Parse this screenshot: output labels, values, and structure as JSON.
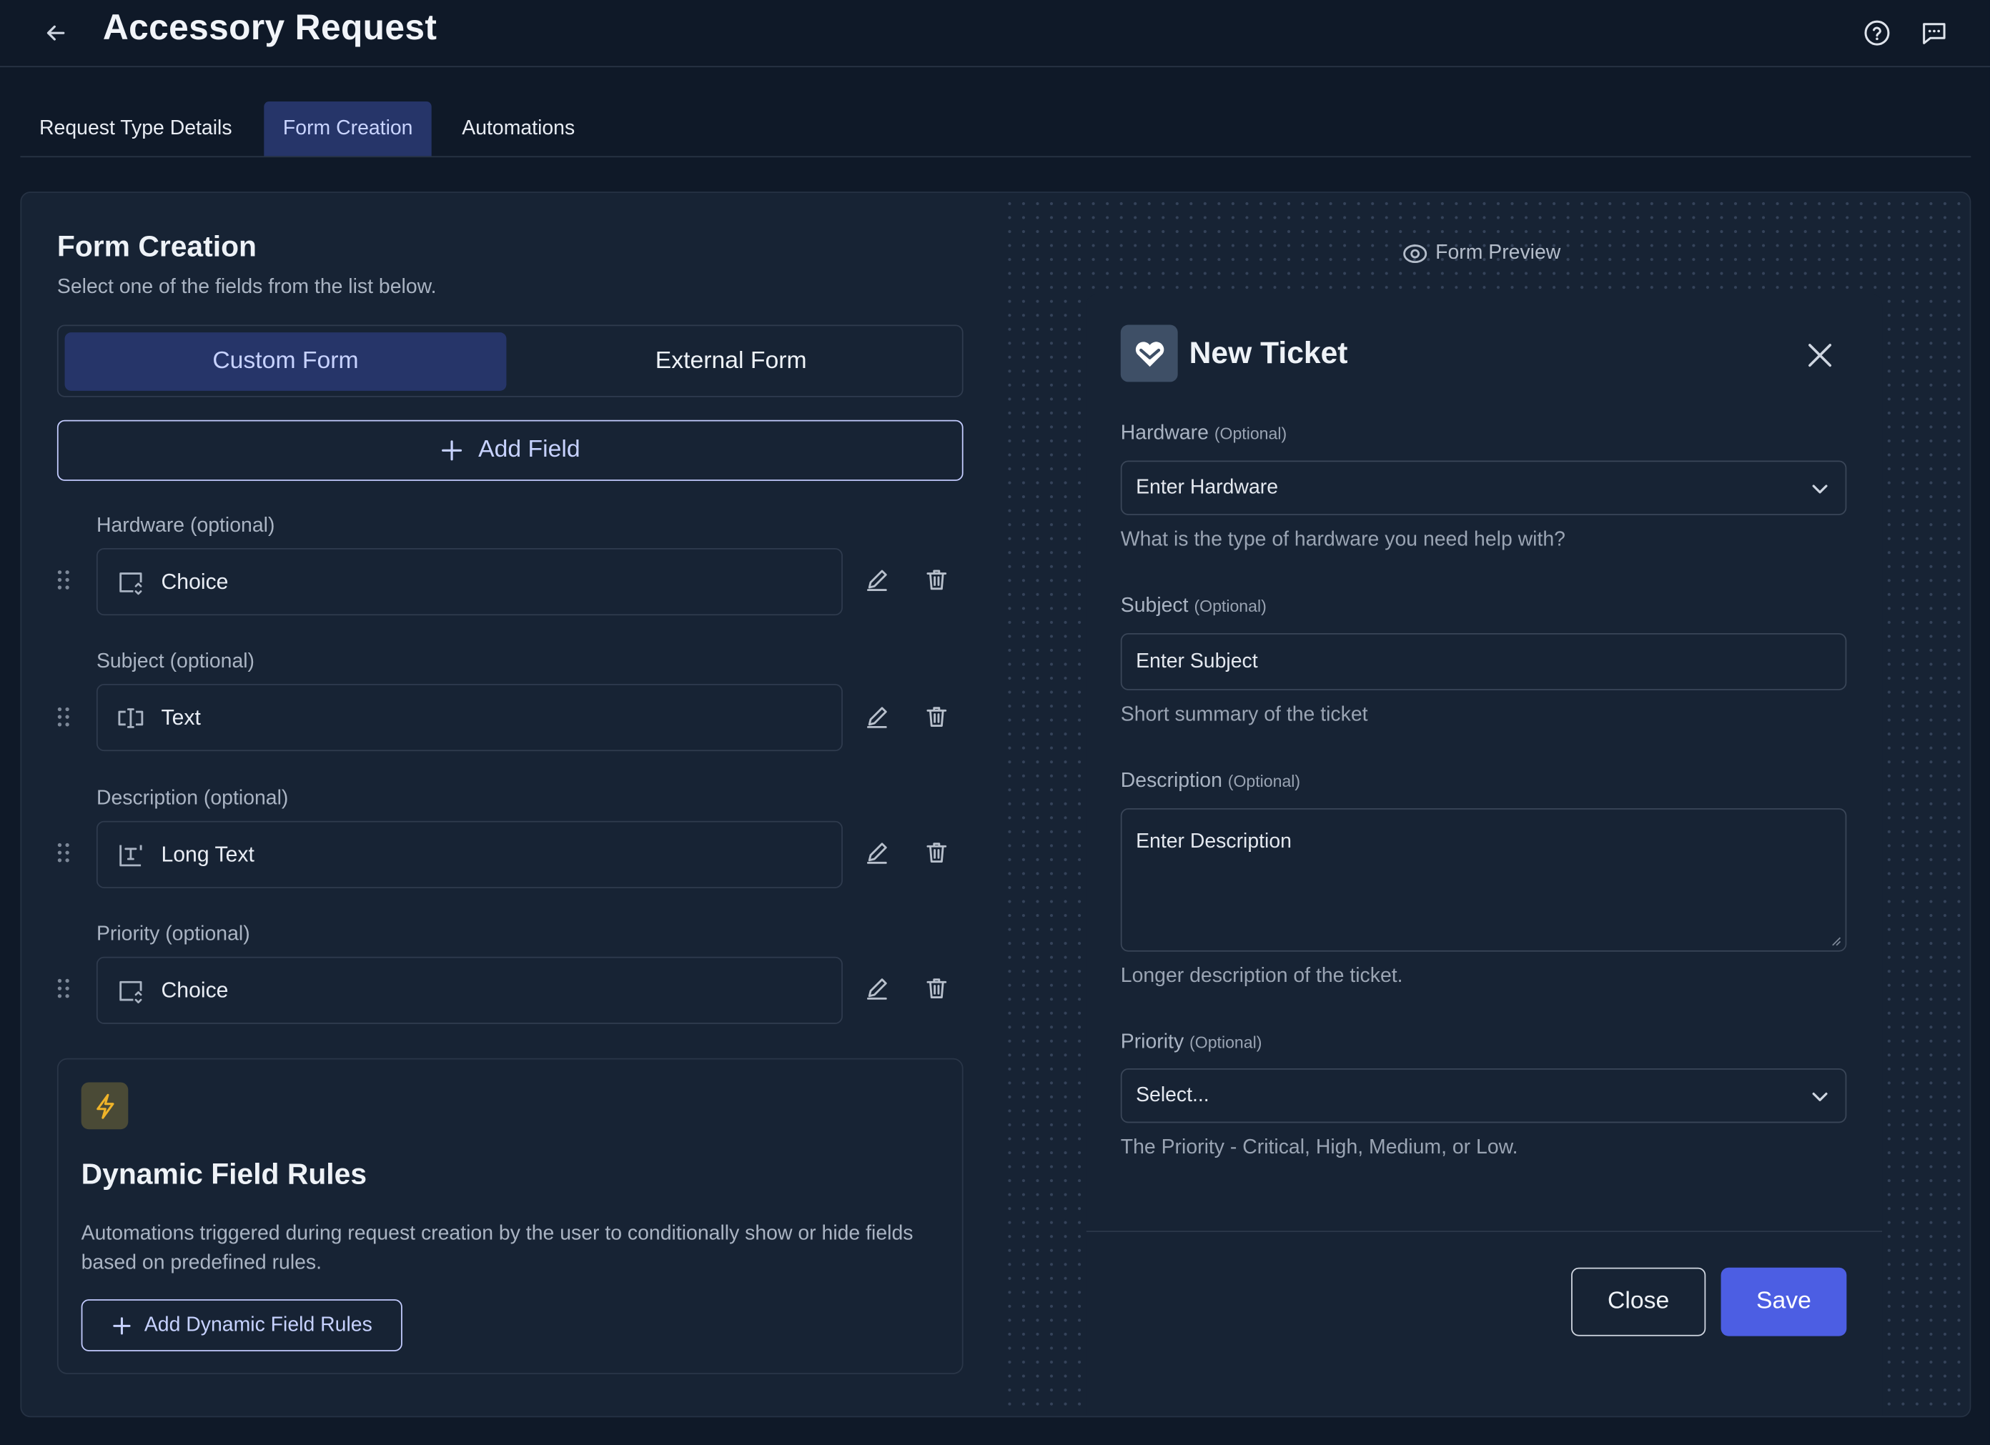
{
  "header": {
    "title": "Accessory Request",
    "back_icon": "arrow-left-icon",
    "help_icon": "help-circle-icon",
    "chat_icon": "message-square-icon"
  },
  "tabs": [
    {
      "label": "Request Type Details",
      "active": false
    },
    {
      "label": "Form Creation",
      "active": true
    },
    {
      "label": "Automations",
      "active": false
    }
  ],
  "builder": {
    "title": "Form Creation",
    "subtitle": "Select one of the fields from the list below.",
    "segments": {
      "custom": "Custom Form",
      "external": "External Form",
      "selected": "custom"
    },
    "add_field_label": "Add Field",
    "fields": [
      {
        "label": "Hardware (optional)",
        "type": "Choice",
        "icon": "choice-icon"
      },
      {
        "label": "Subject (optional)",
        "type": "Text",
        "icon": "text-cursor-icon"
      },
      {
        "label": "Description (optional)",
        "type": "Long Text",
        "icon": "long-text-icon"
      },
      {
        "label": "Priority (optional)",
        "type": "Choice",
        "icon": "choice-icon"
      }
    ],
    "dynamic_rules": {
      "title": "Dynamic Field Rules",
      "description": "Automations triggered during request creation by the user to conditionally show or hide fields based on predefined rules.",
      "button_label": "Add Dynamic Field Rules",
      "icon": "lightning-icon"
    }
  },
  "preview": {
    "label": "Form Preview",
    "ticket_title": "New Ticket",
    "fields": [
      {
        "label": "Hardware",
        "optional": "(Optional)",
        "placeholder": "Enter Hardware",
        "help": "What is the type of hardware you need help with?",
        "kind": "select"
      },
      {
        "label": "Subject",
        "optional": "(Optional)",
        "placeholder": "Enter Subject",
        "help": "Short summary of the ticket",
        "kind": "text"
      },
      {
        "label": "Description",
        "optional": "(Optional)",
        "placeholder": "Enter Description",
        "help": "Longer description of the ticket.",
        "kind": "textarea"
      },
      {
        "label": "Priority",
        "optional": "(Optional)",
        "placeholder": "Select...",
        "help": "The Priority - Critical, High, Medium, or Low.",
        "kind": "select"
      }
    ],
    "close_label": "Close",
    "save_label": "Save"
  },
  "colors": {
    "background": "#0f1928",
    "panel": "#172334",
    "accent": "#4c5ee3",
    "active_tab": "#263569",
    "lightning": "#f0b429"
  }
}
